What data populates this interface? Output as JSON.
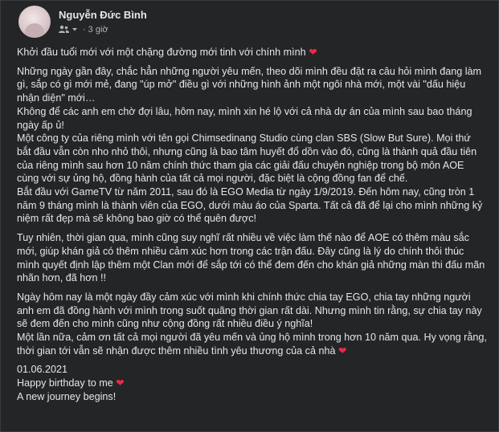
{
  "author": {
    "name": "Nguyễn Đức Bình",
    "time": "3 giờ",
    "separator": "·"
  },
  "icons": {
    "avatar": "profile-avatar",
    "audience": "friends-audience-icon",
    "caret": "dropdown-caret-icon",
    "heart": "red-heart-emoji"
  },
  "colors": {
    "background": "#242526",
    "text": "#e4e6eb",
    "secondary_text": "#b0b3b8",
    "heart": "#f02849"
  },
  "post": {
    "p1": "Khởi đầu tuổi mới với một chặng đường mới tinh với chính mình ",
    "p2": "Những ngày gần đây, chắc hẳn những người yêu mến, theo dõi mình đều đặt ra câu hỏi mình đang làm gì, sắp có gì mới mẻ, đang \"úp mở\" điều gì với những hình ảnh một ngôi nhà mới, một vài \"dấu hiệu nhận diện\" mới…",
    "p3": "Không để các anh em chờ đợi lâu, hôm nay, mình xin hé lộ với cả nhà dự án của mình sau bao tháng ngày ấp ủ!",
    "p4": "Một công ty của riêng mình với tên gọi Chimsedinang Studio cùng clan SBS (Slow But Sure). Mọi thứ bắt đầu vẫn còn nho nhỏ thôi, nhưng cũng là bao tâm huyết đổ dồn vào đó, cũng là thành quả đầu tiên của riêng mình sau hơn 10 năm chính thức tham gia các giải đấu chuyên nghiệp trong bộ môn AOE cùng với sự ủng hộ, đồng hành của tất cả mọi người, đặc biệt là cộng đồng fan để chế.",
    "p5": "Bắt đầu với GameTV từ năm 2011, sau đó là EGO Media từ ngày 1/9/2019. Đến hôm nay, cũng tròn 1 năm 9 tháng mình là thành viên của EGO, dưới màu áo của Sparta. Tất cả đã để lại cho mình những kỷ niệm rất đẹp mà sẽ không bao giờ có thể quên được!",
    "p6": "Tuy nhiên, thời gian qua, mình cũng suy nghĩ rất nhiều về việc làm thế nào để AOE có thêm màu sắc mới, giúp khán giả có thêm nhiều cảm xúc hơn trong các trận đấu. Đây cũng là lý do chính thôi thúc mình quyết định lập thêm một Clan mới để sắp tới có thể đem đến cho khán giả những màn thi đấu mãn nhãn hơn, đã hơn !!",
    "p7": "Ngày hôm nay là một ngày đầy cảm xúc với mình khi chính thức chia tay EGO, chia tay những người anh em đã đồng hành với mình trong suốt quãng thời gian rất dài. Nhưng mình tin rằng, sự chia tay này sẽ đem đến cho mình cũng như cộng đồng rất nhiều điều ý nghĩa!",
    "p8": "Một lần nữa, cảm ơn tất cả mọi người đã yêu mến và ủng hộ mình trong hơn 10 năm qua. Hy vọng rằng, thời gian tới vẫn sẽ nhận được thêm nhiều tình yêu thương của cả nhà ",
    "date": "01.06.2021",
    "birthday": "Happy birthday to me ",
    "journey": "A new journey begins!",
    "heart_glyph": "❤"
  }
}
